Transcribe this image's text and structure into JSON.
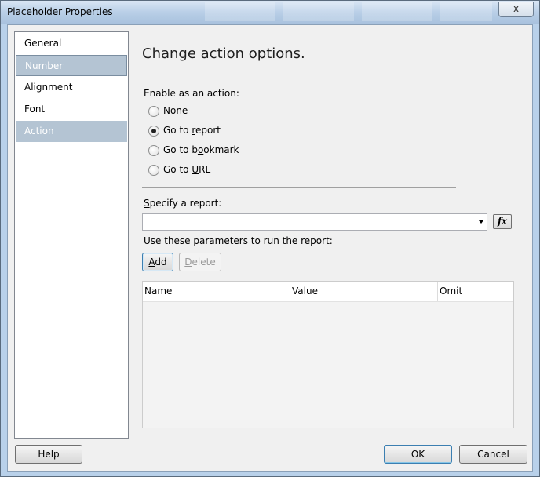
{
  "window": {
    "title": "Placeholder Properties",
    "close_glyph": "x"
  },
  "nav": {
    "items": [
      {
        "label": "General"
      },
      {
        "label": "Number"
      },
      {
        "label": "Alignment"
      },
      {
        "label": "Font"
      },
      {
        "label": "Action"
      }
    ],
    "selected": "Action"
  },
  "main": {
    "heading": "Change action options.",
    "enable_label": "Enable as an action:",
    "radios": [
      {
        "pre": "",
        "mnemonic": "N",
        "post": "one",
        "checked": false
      },
      {
        "pre": "Go to ",
        "mnemonic": "r",
        "post": "eport",
        "checked": true
      },
      {
        "pre": "Go to b",
        "mnemonic": "o",
        "post": "okmark",
        "checked": false
      },
      {
        "pre": "Go to ",
        "mnemonic": "U",
        "post": "RL",
        "checked": false
      }
    ],
    "report_label_mnemonic": "S",
    "report_label_rest": "pecify a report:",
    "report_value": "",
    "fx_label": "fx",
    "params_label": "Use these parameters to run the report:",
    "add_mnemonic": "A",
    "add_rest": "dd",
    "delete_pre": "",
    "delete_mnemonic": "D",
    "delete_rest": "elete",
    "columns": [
      "Name",
      "Value",
      "Omit"
    ]
  },
  "footer": {
    "help": "Help",
    "ok": "OK",
    "cancel": "Cancel"
  },
  "colors": {
    "selection": "#b4c4d3",
    "chrome": "#b9d1ea"
  }
}
